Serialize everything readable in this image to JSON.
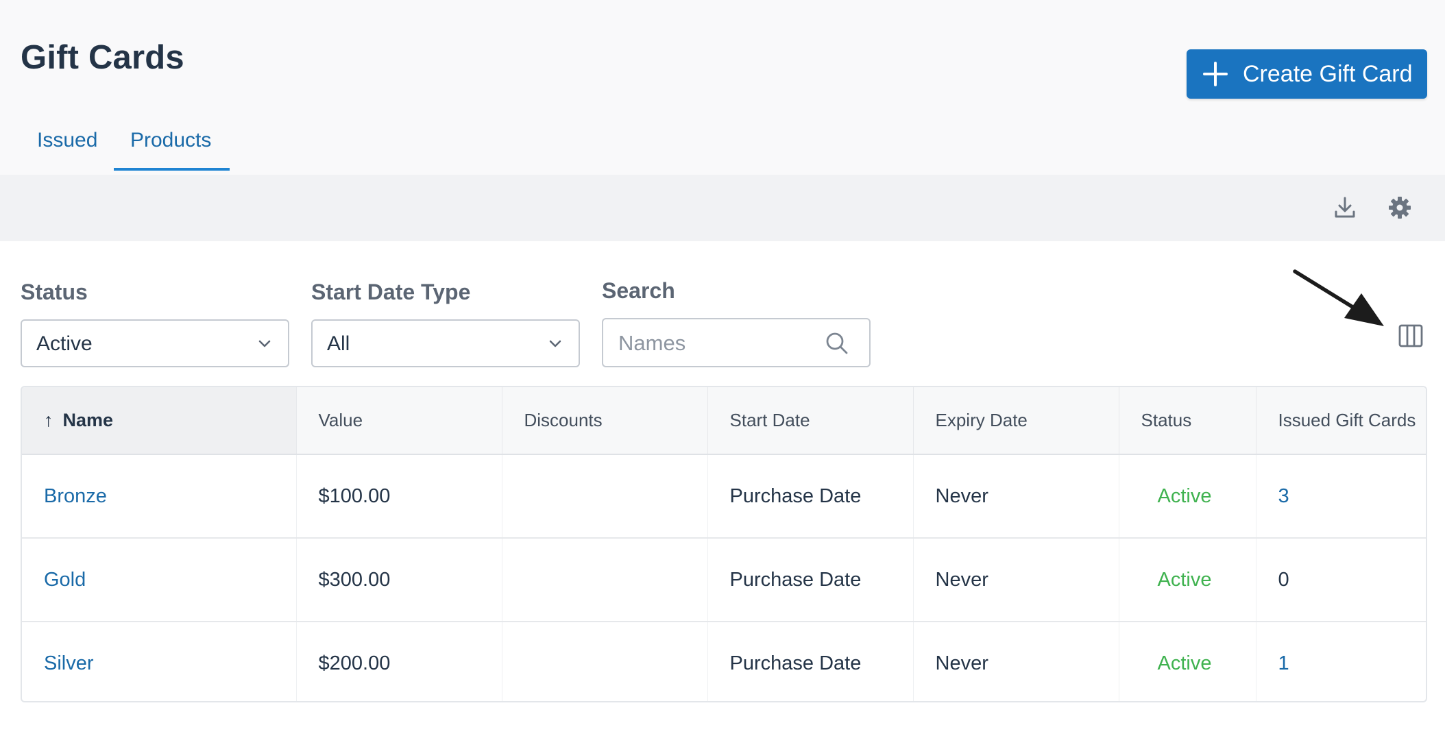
{
  "header": {
    "title": "Gift Cards",
    "create_button_label": "Create Gift Card"
  },
  "tabs": [
    {
      "label": "Issued",
      "active": false
    },
    {
      "label": "Products",
      "active": true
    }
  ],
  "toolbar": {
    "icons": [
      "download-icon",
      "gear-icon"
    ]
  },
  "filters": {
    "status": {
      "label": "Status",
      "value": "Active"
    },
    "start_date_type": {
      "label": "Start Date Type",
      "value": "All"
    },
    "search": {
      "label": "Search",
      "placeholder": "Names",
      "value": ""
    }
  },
  "annotation": {
    "icon": "arrow-pointer",
    "target": "columns-icon"
  },
  "table": {
    "sorted_by": "Name",
    "sort_direction": "ascending",
    "columns": [
      "Name",
      "Value",
      "Discounts",
      "Start Date",
      "Expiry Date",
      "Status",
      "Issued Gift Cards"
    ],
    "rows": [
      {
        "name": "Bronze",
        "value": "$100.00",
        "discounts": "",
        "start_date": "Purchase Date",
        "expiry_date": "Never",
        "status": "Active",
        "issued": "3"
      },
      {
        "name": "Gold",
        "value": "$300.00",
        "discounts": "",
        "start_date": "Purchase Date",
        "expiry_date": "Never",
        "status": "Active",
        "issued": "0"
      },
      {
        "name": "Silver",
        "value": "$200.00",
        "discounts": "",
        "start_date": "Purchase Date",
        "expiry_date": "Never",
        "status": "Active",
        "issued": "1"
      }
    ]
  },
  "colors": {
    "primary": "#1a74c0",
    "link": "#1a6aa8",
    "status_active": "#3fb24f",
    "title": "#243447"
  }
}
